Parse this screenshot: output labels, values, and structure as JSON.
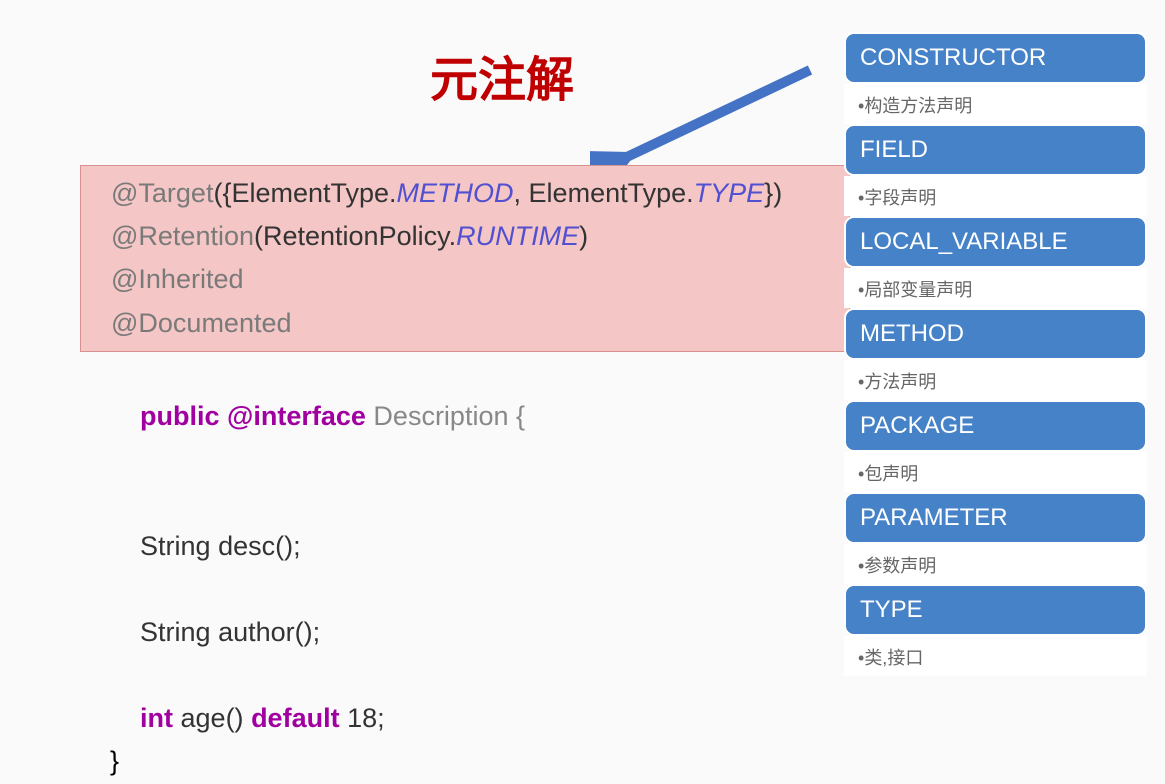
{
  "title": "元注解",
  "code": {
    "anno1_prefix": "@Target",
    "anno1_open": "({ElementType.",
    "anno1_m1": "METHOD",
    "anno1_mid": ", ElementType.",
    "anno1_m2": "TYPE",
    "anno1_close": "})",
    "anno2_prefix": "@Retention",
    "anno2_open": "(RetentionPolicy.",
    "anno2_val": "RUNTIME",
    "anno2_close": ")",
    "anno3": "@Inherited",
    "anno4": "@Documented",
    "decl_public": "public",
    "decl_kw": "@interface",
    "decl_name": " Description {",
    "m1_type": "String ",
    "m1_name": "desc();",
    "m2_type": "String ",
    "m2_name": "author();",
    "m3_type": "int",
    "m3_name": " age() ",
    "m3_default": "default",
    "m3_val": " 18;",
    "close": "}"
  },
  "sidebar": [
    {
      "title": "CONSTRUCTOR",
      "desc": "构造方法声明"
    },
    {
      "title": "FIELD",
      "desc": "字段声明"
    },
    {
      "title": "LOCAL_VARIABLE",
      "desc": "局部变量声明"
    },
    {
      "title": "METHOD",
      "desc": "方法声明"
    },
    {
      "title": "PACKAGE",
      "desc": "包声明"
    },
    {
      "title": "PARAMETER",
      "desc": "参数声明"
    },
    {
      "title": "TYPE",
      "desc": "类,接口"
    }
  ]
}
